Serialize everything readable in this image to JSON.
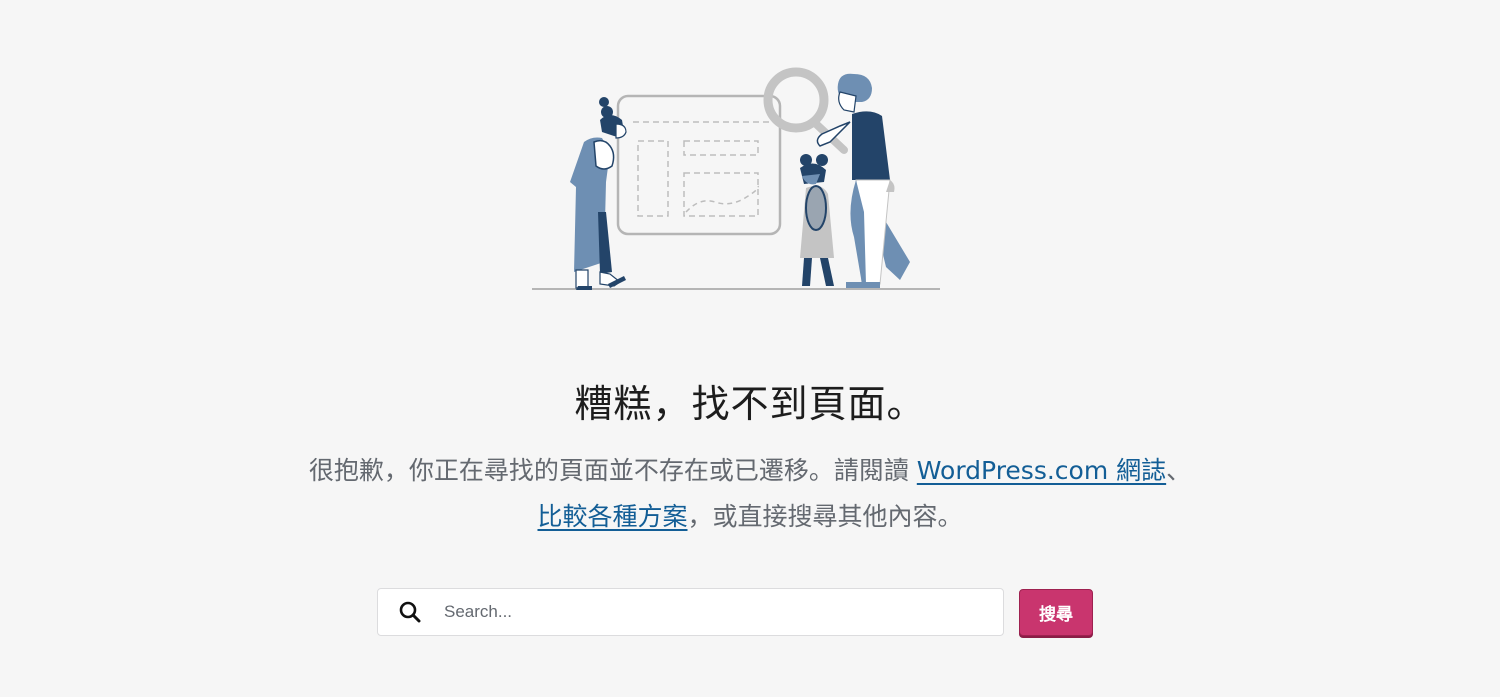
{
  "illustration": {
    "name": "not-found-illustration",
    "description": "Three people looking at a wireframe board with a magnifying glass"
  },
  "heading": {
    "title": "糟糕，找不到頁面。"
  },
  "message": {
    "text_before_link1": "很抱歉，你正在尋找的頁面並不存在或已遷移。請閱讀 ",
    "link1_label": "WordPress.com 網誌",
    "text_between_links": "、",
    "link2_label": "比較各種方案",
    "text_after_link2": "，或直接搜尋其他內容。"
  },
  "search": {
    "icon": "search-icon",
    "placeholder": "Search...",
    "value": "",
    "button_label": "搜尋"
  },
  "colors": {
    "background": "#f6f6f6",
    "link": "#135e96",
    "button": "#c9356e",
    "illustration_dark": "#234469",
    "illustration_mid": "#6e8fb3",
    "illustration_gray": "#c4c4c4"
  }
}
